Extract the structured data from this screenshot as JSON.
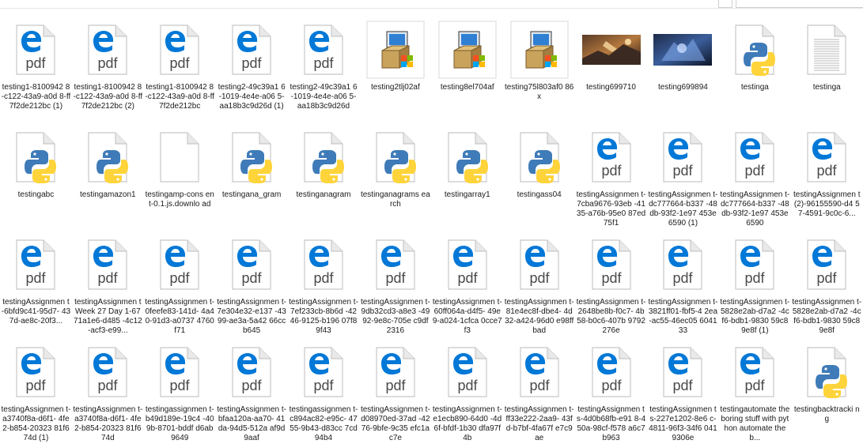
{
  "colors": {
    "edge_blue": "#0078d7",
    "pdf_text": "#4a4a4a",
    "python_blue": "#3e7bb8",
    "python_yellow": "#ffd43b",
    "doc_border": "#c8c8c8",
    "doc_fold": "#e9e9e9"
  },
  "items": [
    {
      "type": "pdf",
      "label": "testing1-8100942 8-c122-43a9-a0d 8-ff7f2de212bc (1)"
    },
    {
      "type": "pdf",
      "label": "testing1-8100942 8-c122-43a9-a0d 8-ff7f2de212bc (2)"
    },
    {
      "type": "pdf",
      "label": "testing1-8100942 8-c122-43a9-a0d 8-ff7f2de212bc"
    },
    {
      "type": "pdf",
      "label": "testing2-49c39a1 6-1019-4e4e-a06 5-aa18b3c9d26d (1)"
    },
    {
      "type": "pdf",
      "label": "testing2-49c39a1 6-1019-4e4e-a06 5-aa18b3c9d26d"
    },
    {
      "type": "installer",
      "label": "testing2tlj02af"
    },
    {
      "type": "installer",
      "label": "testing8el704af"
    },
    {
      "type": "installer",
      "label": "testing75l803af0 86x"
    },
    {
      "type": "image1",
      "label": "testing699710"
    },
    {
      "type": "image2",
      "label": "testing699894"
    },
    {
      "type": "python",
      "label": "testinga"
    },
    {
      "type": "text",
      "label": "testinga"
    },
    {
      "type": "python",
      "label": "testingabc"
    },
    {
      "type": "python",
      "label": "testingamazon1"
    },
    {
      "type": "blank",
      "label": "testingamp-cons ent-0.1.js.downlo ad"
    },
    {
      "type": "python",
      "label": "testingana_gram"
    },
    {
      "type": "python",
      "label": "testinganagram"
    },
    {
      "type": "python",
      "label": "testinganagrams earch"
    },
    {
      "type": "python",
      "label": "testingarray1"
    },
    {
      "type": "python",
      "label": "testingass04"
    },
    {
      "type": "pdf",
      "label": "testingAssignmen t-7cba9676-93eb -4135-a76b-95e0 87ed75f1"
    },
    {
      "type": "pdf",
      "label": "testingAssignmen t-dc777664-b337 -48db-93f2-1e97 453e6590 (1)"
    },
    {
      "type": "pdf",
      "label": "testingAssignmen t-dc777664-b337 -48db-93f2-1e97 453e6590"
    },
    {
      "type": "pdf",
      "label": "testingAssignmen t (2)-96155590-d4 57-4591-9c0c-6..."
    },
    {
      "type": "pdf",
      "label": "testingAssignmen t -6bfd9c41-95d7- 437d-ae8c-20f3..."
    },
    {
      "type": "pdf",
      "label": "testingAssignmen t Week 27 Day 1-6771a1e6-d485 -4c12-acf3-e99..."
    },
    {
      "type": "pdf",
      "label": "testingAssignmen t-0feefe83-141d- 4a40-91d3-a0737 4760f71"
    },
    {
      "type": "pdf",
      "label": "testingAssignmen t-7e304e32-e137 -4399-ae3a-5a42 66ccb645"
    },
    {
      "type": "pdf",
      "label": "testingAssignmen t-7ef233cb-8b6d -4246-9125-b196 07f89f43"
    },
    {
      "type": "pdf",
      "label": "testingAssignmen t-9db32cd3-a8e3 -4992-9e8c-705e c9df2316"
    },
    {
      "type": "pdf",
      "label": "testingAssignmen t-60ff064a-d4f5- 49e9-a024-1cfca 0cce7f3"
    },
    {
      "type": "pdf",
      "label": "testingAssignmen t-81e4ec8f-dbe4- 4d32-a424-96d0 e98ffbad"
    },
    {
      "type": "pdf",
      "label": "testingAssignmen t-2648be8b-f0c7- 4b58-b0c6-407b 9792276e"
    },
    {
      "type": "pdf",
      "label": "testingAssignmen t-3821ff01-fbf5-4 2ea-ac55-46ec05 604133"
    },
    {
      "type": "pdf",
      "label": "testingAssignmen t-5828e2ab-d7a2 -4cf6-bdb1-9830 59c89e8f (1)"
    },
    {
      "type": "pdf",
      "label": "testingAssignmen t-5828e2ab-d7a2 -4cf6-bdb1-9830 59c89e8f"
    },
    {
      "type": "pdf",
      "label": "testingAssignmen t-a3740f8a-d6f1- 4fe2-b854-20323 81f674d (1)"
    },
    {
      "type": "pdf",
      "label": "testingAssignmen t-a3740f8a-d6f1- 4fe2-b854-20323 81f674d"
    },
    {
      "type": "pdf",
      "label": "testingassignmen t-b49d189e-19c4 -409b-8701-bddf d6ab9649"
    },
    {
      "type": "pdf",
      "label": "testingAssignmen t-bfaa120a-aa70- 41da-94d5-512a af9d9aaf"
    },
    {
      "type": "pdf",
      "label": "testingassignmen t-c894ac82-e95c- 4755-9b43-d83cc 7cd94b4"
    },
    {
      "type": "pdf",
      "label": "testingAssignmen t-d08970ed-37ad -4276-9bfe-9c35 efc1ac7e"
    },
    {
      "type": "pdf",
      "label": "testingAssignmen t-e1ecb890-64d0 -4d6f-bfdf-1b30 dfa97f4b"
    },
    {
      "type": "pdf",
      "label": "testingAssignmen t-ff33e222-2aa9- 43fd-b7bf-4fa67f e7c9ae"
    },
    {
      "type": "pdf",
      "label": "testingAssignmen ts-4d0b68fb-e91 8-450a-98cf-f578 a6c7b963"
    },
    {
      "type": "pdf",
      "label": "testingAssignmen ts-227e1202-8e6 c-4811-96f3-34f6 0419306e"
    },
    {
      "type": "pdf",
      "label": "testingautomate the boring stuff with python automate the b..."
    },
    {
      "type": "python",
      "label": "testingbacktracki ng"
    }
  ]
}
